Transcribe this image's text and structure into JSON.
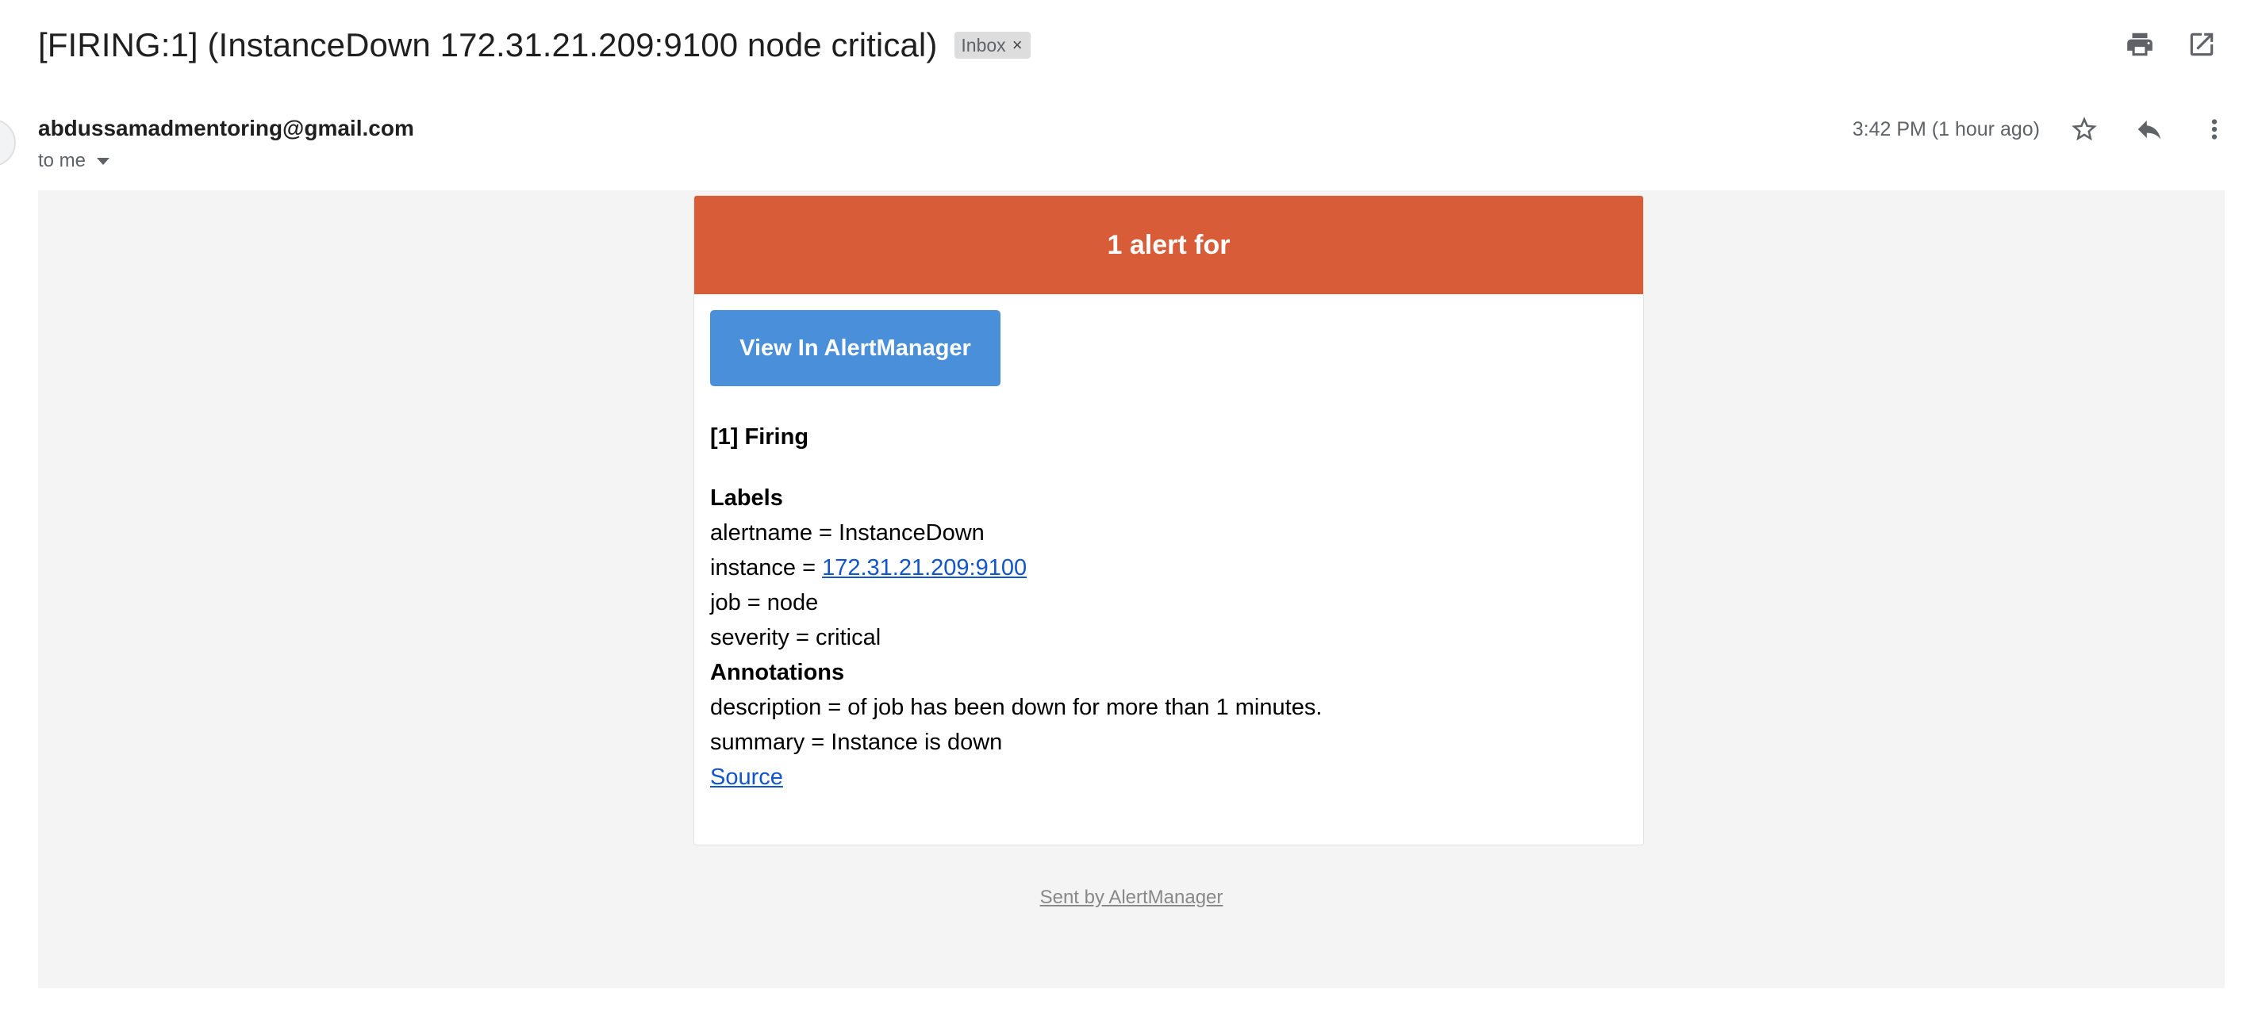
{
  "header": {
    "subject": "[FIRING:1] (InstanceDown 172.31.21.209:9100 node critical)",
    "label_chip": "Inbox",
    "label_chip_close": "×",
    "icons": [
      "print-icon",
      "open-in-new-window-icon"
    ]
  },
  "sender": {
    "email": "abdussamadmentoring@gmail.com",
    "to": "to me",
    "timestamp": "3:42 PM (1 hour ago)",
    "icons": [
      "star-icon",
      "reply-icon",
      "more-vert-icon"
    ]
  },
  "alert_email": {
    "header_text": "1 alert for",
    "button_label": "View In AlertManager",
    "firing_title": "[1] Firing",
    "labels_heading": "Labels",
    "labels": {
      "alertname_prefix": "alertname = ",
      "alertname_value": "InstanceDown",
      "instance_prefix": "instance = ",
      "instance_value": "172.31.21.209:9100",
      "job_prefix": "job = ",
      "job_value": "node",
      "severity_prefix": "severity = ",
      "severity_value": "critical"
    },
    "annotations_heading": "Annotations",
    "annotations": {
      "description": "description = of job has been down for more than 1 minutes.",
      "summary": "summary = Instance is down"
    },
    "source_link": "Source",
    "footer": "Sent by AlertManager"
  },
  "colors": {
    "alert_header": "#d85c38",
    "button": "#4a8fd9",
    "link": "#1155cc",
    "body_background": "#f4f4f4"
  }
}
